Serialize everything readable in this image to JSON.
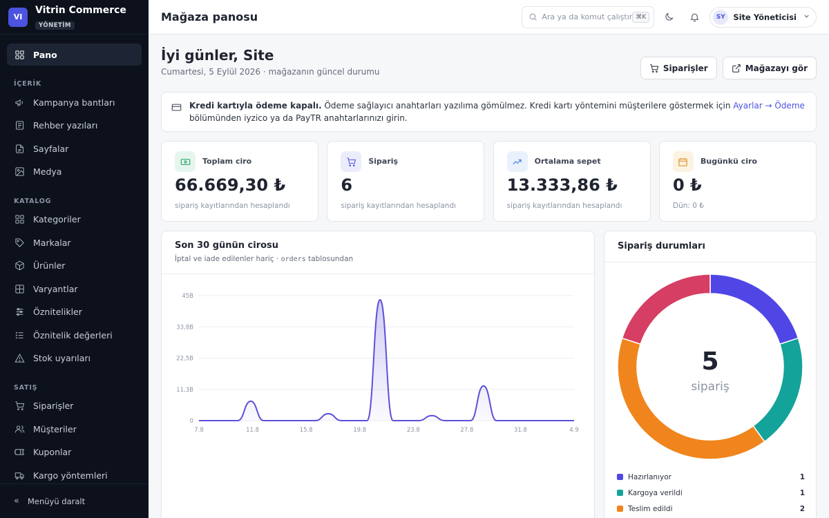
{
  "brand": {
    "logo": "VI",
    "name": "Vitrin Commerce",
    "badge": "YÖNETİM"
  },
  "nav": {
    "top": [
      {
        "label": "Pano",
        "icon": "grid-icon",
        "active": true
      }
    ],
    "sections": [
      {
        "title": "İÇERİK",
        "items": [
          {
            "label": "Kampanya bantları",
            "icon": "megaphone-icon"
          },
          {
            "label": "Rehber yazıları",
            "icon": "newspaper-icon"
          },
          {
            "label": "Sayfalar",
            "icon": "file-icon"
          },
          {
            "label": "Medya",
            "icon": "image-icon"
          }
        ]
      },
      {
        "title": "KATALOG",
        "items": [
          {
            "label": "Kategoriler",
            "icon": "grid-icon"
          },
          {
            "label": "Markalar",
            "icon": "tag-icon"
          },
          {
            "label": "Ürünler",
            "icon": "box-icon"
          },
          {
            "label": "Varyantlar",
            "icon": "layout-icon"
          },
          {
            "label": "Öznitelikler",
            "icon": "sliders-icon"
          },
          {
            "label": "Öznitelik değerleri",
            "icon": "list-icon"
          },
          {
            "label": "Stok uyarıları",
            "icon": "alert-icon"
          }
        ]
      },
      {
        "title": "SATIŞ",
        "items": [
          {
            "label": "Siparişler",
            "icon": "cart-icon"
          },
          {
            "label": "Müşteriler",
            "icon": "users-icon"
          },
          {
            "label": "Kuponlar",
            "icon": "ticket-icon"
          },
          {
            "label": "Kargo yöntemleri",
            "icon": "truck-icon"
          }
        ]
      }
    ],
    "collapse_label": "Menüyü daralt"
  },
  "header": {
    "title": "Mağaza panosu",
    "search_placeholder": "Ara ya da komut çalıştır",
    "search_kbd": "⌘K",
    "user_initials": "SY",
    "user_name": "Site Yöneticisi"
  },
  "main": {
    "greeting": "İyi günler, Site",
    "subtitle": "Cumartesi, 5 Eylül 2026 · mağazanın güncel durumu",
    "btn_orders": "Siparişler",
    "btn_store": "Mağazayı gör"
  },
  "notice": {
    "bold": "Kredi kartıyla ödeme kapalı.",
    "text1": " Ödeme sağlayıcı anahtarları yazılıma gömülmez. Kredi kartı yöntemini müşterilere göstermek için ",
    "link": "Ayarlar → Ödeme",
    "text2": " bölümünden iyzico ya da PayTR anahtarlarınızı girin."
  },
  "stats": [
    {
      "label": "Toplam ciro",
      "value": "66.669,30 ₺",
      "note": "sipariş kayıtlarından hesaplandı",
      "icon": "banknote-icon",
      "color": "#1a9d5b",
      "bg": "#e6f6ee"
    },
    {
      "label": "Sipariş",
      "value": "6",
      "note": "sipariş kayıtlarından hesaplandı",
      "icon": "cart-icon",
      "color": "#4b53e0",
      "bg": "#ecedfc"
    },
    {
      "label": "Ortalama sepet",
      "value": "13.333,86 ₺",
      "note": "sipariş kayıtlarından hesaplandı",
      "icon": "trend-up-icon",
      "color": "#3a78d8",
      "bg": "#e9f1fc"
    },
    {
      "label": "Bugünkü ciro",
      "value": "0 ₺",
      "note": "Dün: 0 ₺",
      "icon": "calendar-icon",
      "color": "#d98a17",
      "bg": "#fdf3e2"
    }
  ],
  "revenue_card": {
    "title": "Son 30 günün cirosu",
    "sub_prefix": "İptal ve iade edilenler hariç · ",
    "sub_code": "orders",
    "sub_suffix": " tablosundan"
  },
  "chart_data": {
    "type": "area",
    "title": "Son 30 günün cirosu",
    "xlabel": "",
    "ylabel": "",
    "x_ticks": [
      "7.8",
      "11.8",
      "15.8",
      "19.8",
      "23.8",
      "27.8",
      "31.8",
      "4.9"
    ],
    "y_ticks": [
      "0",
      "11,3B",
      "22,5B",
      "33,8B",
      "45B"
    ],
    "ylim": [
      0,
      45000
    ],
    "grid": true,
    "color": "#5b4fd9",
    "x": [
      0,
      1,
      2,
      3,
      4,
      5,
      6,
      7,
      8,
      9,
      10,
      11,
      12,
      13,
      14,
      15,
      16,
      17,
      18,
      19,
      20,
      21,
      22,
      23,
      24,
      25,
      26,
      27,
      28,
      29
    ],
    "values": [
      0,
      0,
      0,
      0,
      7000,
      0,
      0,
      0,
      0,
      0,
      2500,
      0,
      0,
      0,
      43500,
      0,
      0,
      0,
      1800,
      0,
      0,
      0,
      12500,
      0,
      0,
      0,
      0,
      0,
      0,
      0
    ]
  },
  "status_card": {
    "title": "Sipariş durumları",
    "center_value": "5",
    "center_label": "sipariş"
  },
  "status_chart": {
    "type": "pie",
    "slices": [
      {
        "label": "Hazırlanıyor",
        "value": 1,
        "color": "#4f46e5"
      },
      {
        "label": "Kargoya verildi",
        "value": 1,
        "color": "#14a39a"
      },
      {
        "label": "Teslim edildi",
        "value": 2,
        "color": "#f0851d"
      },
      {
        "label": "",
        "value": 1,
        "color": "#d63e63"
      }
    ]
  }
}
